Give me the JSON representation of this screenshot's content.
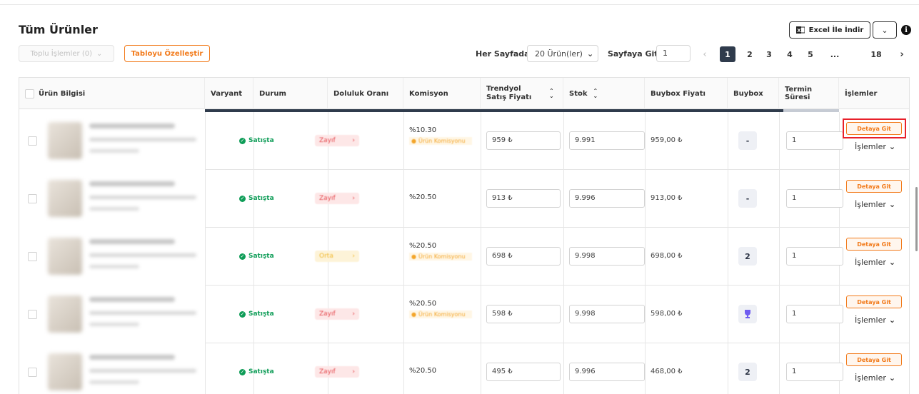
{
  "page": {
    "title": "Tüm Ürünler"
  },
  "toolbar": {
    "bulk_actions_label": "Toplu İşlemler (0)",
    "customize_table_label": "Tabloyu Özelleştir",
    "per_page_label": "Her Sayfada",
    "per_page_value": "20 Ürün(ler)",
    "goto_page_label": "Sayfaya Git",
    "goto_page_value": "1",
    "excel_download_label": "Excel İle İndir"
  },
  "pagination": {
    "pages": [
      "1",
      "2",
      "3",
      "4",
      "5",
      "...",
      "18"
    ],
    "current": "1"
  },
  "table": {
    "columns": [
      "Ürün Bilgisi",
      "Varyant",
      "Durum",
      "Doluluk Oranı",
      "Komisyon",
      "Trendyol Satış Fiyatı",
      "Stok",
      "Buybox Fiyatı",
      "Buybox",
      "Termin Süresi",
      "İşlemler"
    ],
    "detail_button_label": "Detaya Git",
    "actions_label": "İşlemler",
    "commission_tag_label": "Ürün Komisyonu",
    "rows": [
      {
        "status": "Satışta",
        "fill": "Zayıf",
        "fill_level": "weak",
        "commission": "%10.30",
        "has_commission_tag": true,
        "price": "959 ₺",
        "stock": "9.991",
        "buybox_price": "959,00 ₺",
        "buybox": "-",
        "lead_time": "1",
        "highlighted": true
      },
      {
        "status": "Satışta",
        "fill": "Zayıf",
        "fill_level": "weak",
        "commission": "%20.50",
        "has_commission_tag": false,
        "price": "913 ₺",
        "stock": "9.996",
        "buybox_price": "913,00 ₺",
        "buybox": "-",
        "lead_time": "1",
        "highlighted": false
      },
      {
        "status": "Satışta",
        "fill": "Orta",
        "fill_level": "mid",
        "commission": "%20.50",
        "has_commission_tag": true,
        "price": "698 ₺",
        "stock": "9.998",
        "buybox_price": "698,00 ₺",
        "buybox": "2",
        "lead_time": "1",
        "highlighted": false
      },
      {
        "status": "Satışta",
        "fill": "Zayıf",
        "fill_level": "weak",
        "commission": "%20.50",
        "has_commission_tag": true,
        "price": "598 ₺",
        "stock": "9.998",
        "buybox_price": "598,00 ₺",
        "buybox": "trophy",
        "lead_time": "1",
        "highlighted": false
      },
      {
        "status": "Satışta",
        "fill": "Zayıf",
        "fill_level": "weak",
        "commission": "%20.50",
        "has_commission_tag": false,
        "price": "495 ₺",
        "stock": "9.996",
        "buybox_price": "468,00 ₺",
        "buybox": "2",
        "lead_time": "1",
        "highlighted": false
      }
    ]
  },
  "colors": {
    "accent": "#f27a1a",
    "success": "#0f9d58",
    "highlight": "#e8202a"
  }
}
